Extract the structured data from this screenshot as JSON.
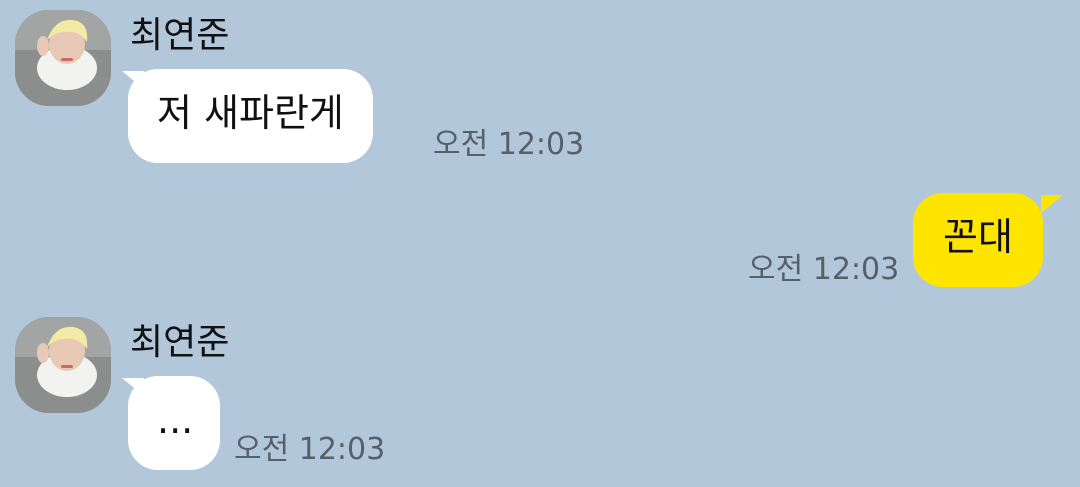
{
  "chat": {
    "messages": [
      {
        "sender": "최연준",
        "text": "저 새파란게",
        "time": "오전 12:03",
        "avatar_icon": "profile-photo"
      },
      {
        "sender": "me",
        "text": "꼰대",
        "time": "오전 12:03"
      },
      {
        "sender": "최연준",
        "text": "...",
        "time": "오전 12:03",
        "avatar_icon": "profile-photo"
      }
    ]
  },
  "colors": {
    "background": "#b2c7da",
    "received_bubble": "#ffffff",
    "sent_bubble": "#fee500",
    "time_text": "#55606a"
  }
}
